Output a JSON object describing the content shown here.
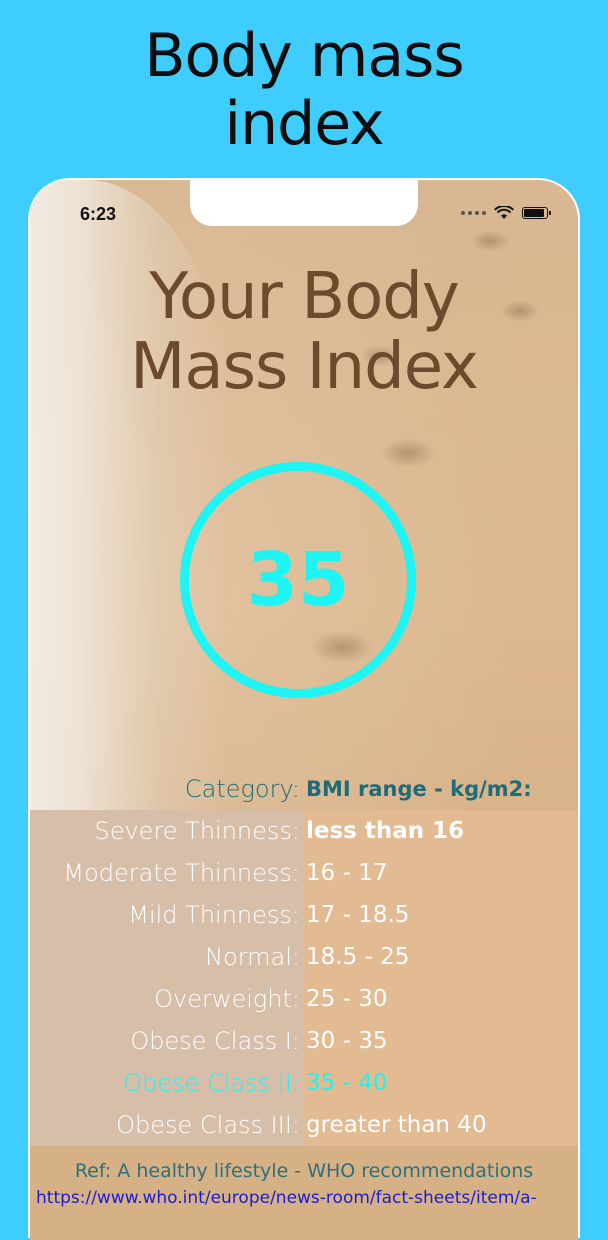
{
  "promo": {
    "title_line1": "Body mass",
    "title_line2": "index"
  },
  "status_bar": {
    "time": "6:23",
    "icons": [
      "signal-dots-icon",
      "wifi-icon",
      "battery-icon"
    ]
  },
  "screen": {
    "heading_line1": "Your Body",
    "heading_line2": "Mass Index",
    "bmi_value": "35",
    "ring_color": "#1ef4f3"
  },
  "table": {
    "header": {
      "category": "Category:",
      "range": "BMI range - kg/m2:"
    },
    "rows": [
      {
        "category": "Severe Thinness:",
        "range": "less than 16"
      },
      {
        "category": "Moderate Thinness:",
        "range": "16 - 17"
      },
      {
        "category": "Mild Thinness:",
        "range": "17 - 18.5"
      },
      {
        "category": "Normal:",
        "range": "18.5 - 25"
      },
      {
        "category": "Overweight:",
        "range": "25 - 30"
      },
      {
        "category": "Obese Class I:",
        "range": "30 - 35"
      },
      {
        "category": "Obese Class II:",
        "range": "35 - 40",
        "highlighted": true
      },
      {
        "category": "Obese Class III:",
        "range": "greater than 40"
      }
    ]
  },
  "footer": {
    "reference": "Ref: A healthy lifestyle - WHO recommendations",
    "link": "https://www.who.int/europe/news-room/fact-sheets/item/a-"
  },
  "colors": {
    "background": "#3fcdfd",
    "accent": "#1ef4f3",
    "heading": "#6b4a2d",
    "link": "#1c1cd0"
  }
}
